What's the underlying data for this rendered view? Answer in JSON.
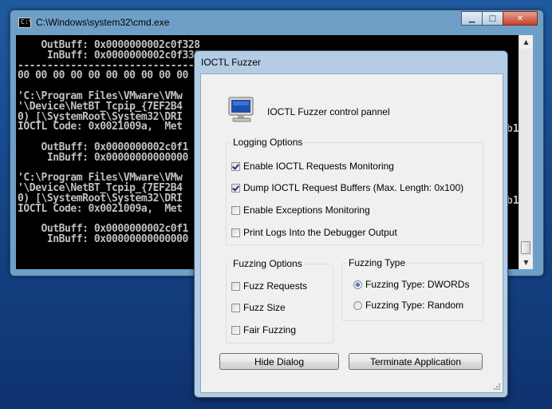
{
  "cmd": {
    "title": "C:\\Windows\\system32\\cmd.exe",
    "icon_text": "C:\\",
    "lines": [
      "    OutBuff: 0x0000000002c0f328",
      "     InBuff: 0x0000000002c0f338",
      "----------------------------------------------------------------------------",
      "00 00 00 00 00 00 00 00 00 00",
      "",
      "'C:\\Program Files\\VMware\\VMw",
      "'\\Device\\NetBT_Tcpip_{7EF2B4",
      "0) [\\SystemRoot\\System32\\DRI",
      "IOCTL Code: 0x0021009a,  Met",
      "",
      "    OutBuff: 0x0000000002c0f1",
      "     InBuff: 0x00000000000000",
      "",
      "'C:\\Program Files\\VMware\\VMw",
      "'\\Device\\NetBT_Tcpip_{7EF2B4",
      "0) [\\SystemRoot\\System32\\DRI",
      "IOCTL Code: 0x0021009a,  Met",
      "",
      "    OutBuff: 0x0000000002c0f1",
      "     InBuff: 0x00000000000000"
    ],
    "right_fragments": [
      "b1",
      "b1"
    ]
  },
  "dialog": {
    "title": "IOCTL Fuzzer",
    "header_text": "IOCTL Fuzzer control pannel",
    "logging": {
      "title": "Logging Options",
      "items": [
        {
          "label": "Enable IOCTL Requests Monitoring",
          "checked": true
        },
        {
          "label": "Dump IOCTL Request Buffers (Max. Length: 0x100)",
          "checked": true
        },
        {
          "label": "Enable Exceptions Monitoring",
          "checked": false
        },
        {
          "label": "Print Logs Into the Debugger Output",
          "checked": false
        }
      ]
    },
    "fuzzing_options": {
      "title": "Fuzzing Options",
      "items": [
        {
          "label": "Fuzz Requests",
          "checked": false
        },
        {
          "label": "Fuzz Size",
          "checked": false
        },
        {
          "label": "Fair Fuzzing",
          "checked": false
        }
      ]
    },
    "fuzzing_type": {
      "title": "Fuzzing Type",
      "items": [
        {
          "label": "Fuzzing Type: DWORDs",
          "selected": true
        },
        {
          "label": "Fuzzing Type: Random",
          "selected": false
        }
      ]
    },
    "hide_button": "Hide Dialog",
    "terminate_button": "Terminate Application"
  }
}
